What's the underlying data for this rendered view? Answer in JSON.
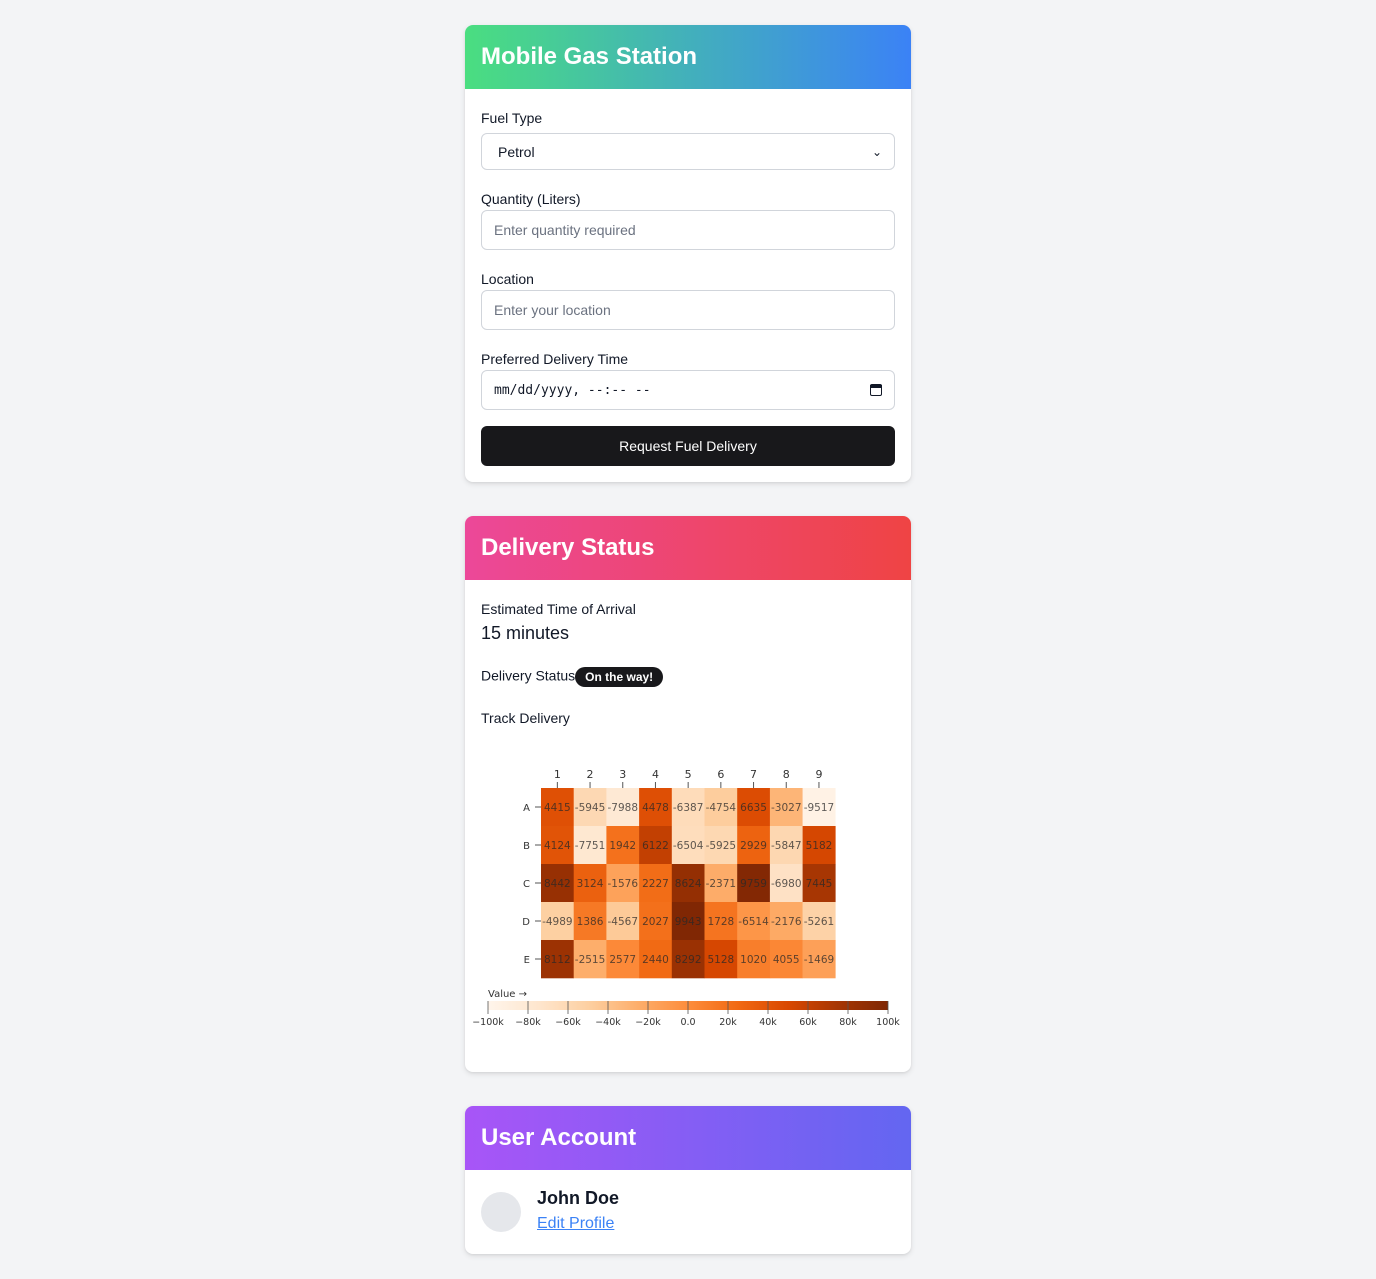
{
  "order": {
    "title": "Mobile Gas Station",
    "fuel_type_label": "Fuel Type",
    "fuel_type_value": "Petrol",
    "quantity_label": "Quantity (Liters)",
    "quantity_placeholder": "Enter quantity required",
    "location_label": "Location",
    "location_placeholder": "Enter your location",
    "delivery_time_label": "Preferred Delivery Time",
    "delivery_time_placeholder": "mm/dd/yyyy, --:-- --",
    "submit_label": "Request Fuel Delivery",
    "header_gradient": [
      "#4ade80",
      "#3b82f6"
    ]
  },
  "status": {
    "title": "Delivery Status",
    "eta_label": "Estimated Time of Arrival",
    "eta_value": "15 minutes",
    "status_label": "Delivery Status",
    "status_badge": "On the way!",
    "track_label": "Track Delivery",
    "header_gradient": [
      "#ec4899",
      "#ef4444"
    ]
  },
  "account": {
    "title": "User Account",
    "user_name": "John Doe",
    "edit_link": "Edit Profile",
    "header_gradient": [
      "#a855f7",
      "#6366f1"
    ]
  },
  "chart_data": {
    "type": "heatmap",
    "columns": [
      "1",
      "2",
      "3",
      "4",
      "5",
      "6",
      "7",
      "8",
      "9"
    ],
    "rows": [
      "A",
      "B",
      "C",
      "D",
      "E"
    ],
    "values": [
      [
        44150,
        -59456,
        -79886,
        44478,
        -63874,
        -47542,
        46635,
        -30278,
        -95178
      ],
      [
        41241,
        -77516,
        19422,
        61220,
        -65044,
        -59254,
        29299,
        -58470,
        51828
      ],
      [
        84426,
        31248,
        -15766,
        22271,
        86246,
        -23717,
        97595,
        -69800,
        74453
      ],
      [
        -49899,
        13864,
        -45673,
        20270,
        99430,
        17283,
        -6514,
        -21766,
        -52610
      ],
      [
        81123,
        -25153,
        2577,
        24409,
        82923,
        51283,
        10208,
        4055,
        -14699
      ]
    ],
    "cell_labels": [
      [
        "4415",
        "-5945",
        "-7988",
        "4478",
        "-6387",
        "-4754",
        "6635",
        "-3027",
        "-9517"
      ],
      [
        "4124",
        "-7751",
        "1942",
        "6122",
        "-6504",
        "-5925",
        "2929",
        "-5847",
        "5182"
      ],
      [
        "8442",
        "3124",
        "-1576",
        "2227",
        "8624",
        "-2371",
        "9759",
        "-6980",
        "7445"
      ],
      [
        "-4989",
        "1386",
        "-4567",
        "2027",
        "9943",
        "1728",
        "-6514",
        "-2176",
        "-5261"
      ],
      [
        "8112",
        "-2515",
        "2577",
        "2440",
        "8292",
        "5128",
        "1020",
        "4055",
        "-1469"
      ]
    ],
    "color_domain": [
      -100000,
      100000
    ],
    "color_range": [
      "#fff5eb",
      "#7f2704"
    ],
    "legend_title": "Value →",
    "legend_ticks": [
      "−100k",
      "−80k",
      "−60k",
      "−40k",
      "−20k",
      "0.0",
      "20k",
      "40k",
      "60k",
      "80k",
      "100k"
    ]
  }
}
